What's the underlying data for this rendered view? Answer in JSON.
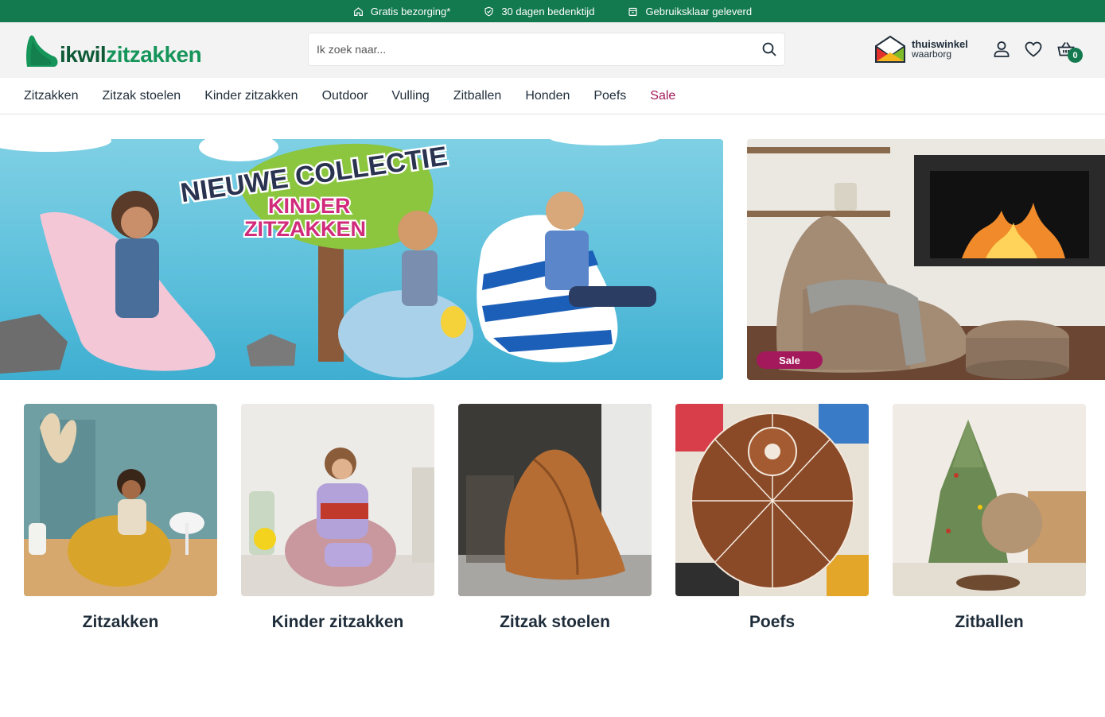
{
  "usp": [
    {
      "icon": "home-icon",
      "text": "Gratis bezorging*"
    },
    {
      "icon": "shield-check-icon",
      "text": "30 dagen bedenktijd"
    },
    {
      "icon": "package-icon",
      "text": "Gebruiksklaar geleverd"
    }
  ],
  "header": {
    "logo_part1": "ikwil",
    "logo_part2": "zitzakken",
    "search_placeholder": "Ik zoek naar...",
    "trust_name": "thuiswinkel",
    "trust_sub": "waarborg",
    "cart_count": "0"
  },
  "nav": [
    {
      "label": "Zitzakken"
    },
    {
      "label": "Zitzak stoelen"
    },
    {
      "label": "Kinder zitzakken"
    },
    {
      "label": "Outdoor"
    },
    {
      "label": "Vulling"
    },
    {
      "label": "Zitballen"
    },
    {
      "label": "Honden"
    },
    {
      "label": "Poefs"
    },
    {
      "label": "Sale"
    }
  ],
  "banner_main": {
    "headline": "NIEUWE COLLECTIE",
    "line1": "KINDER",
    "line2": "ZITZAKKEN"
  },
  "banner_side": {
    "badge": "Sale"
  },
  "categories": [
    {
      "label": "Zitzakken"
    },
    {
      "label": "Kinder zitzakken"
    },
    {
      "label": "Zitzak stoelen"
    },
    {
      "label": "Poefs"
    },
    {
      "label": "Zitballen"
    }
  ],
  "colors": {
    "brand_green": "#137a4f",
    "sale": "#a3195b",
    "text": "#1f2d3a"
  }
}
